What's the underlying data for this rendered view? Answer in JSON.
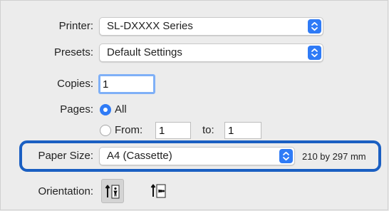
{
  "printer": {
    "label": "Printer:",
    "value": "SL-DXXXX Series"
  },
  "presets": {
    "label": "Presets:",
    "value": "Default Settings"
  },
  "copies": {
    "label": "Copies:",
    "value": "1"
  },
  "pages": {
    "label": "Pages:",
    "all_label": "All",
    "from_label": "From:",
    "from_value": "1",
    "to_label": "to:",
    "to_value": "1",
    "selected": "All"
  },
  "paper_size": {
    "label": "Paper Size:",
    "value": "A4 (Cassette)",
    "dimensions": "210 by 297 mm"
  },
  "orientation": {
    "label": "Orientation:",
    "selected": "portrait"
  },
  "colors": {
    "accent": "#2f7bf6",
    "highlight_border": "#1a5fc2",
    "focus_ring": "#7fb0f7"
  }
}
